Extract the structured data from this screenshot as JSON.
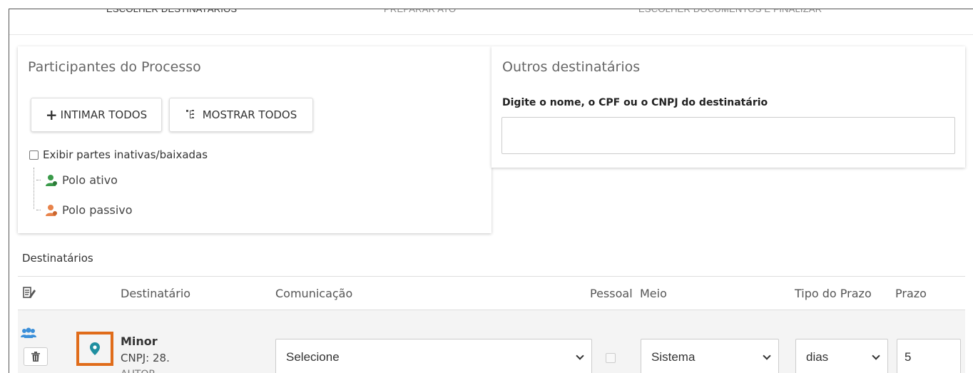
{
  "steps": [
    "Escolher destinatários",
    "Preparar ato",
    "Escolher documentos e finalizar"
  ],
  "participants": {
    "title": "Participantes do Processo",
    "intimar_label": "INTIMAR TODOS",
    "mostrar_label": "MOSTRAR TODOS",
    "checkbox_label": "Exibir partes inativas/baixadas",
    "checkbox_checked": false,
    "polos": [
      {
        "label": "Polo ativo",
        "icon": "user-green-icon",
        "color": "#3a9a4a"
      },
      {
        "label": "Polo passivo",
        "icon": "user-orange-icon",
        "color": "#e8834a"
      }
    ]
  },
  "others": {
    "title": "Outros destinatários",
    "field_label": "Digite o nome, o CPF ou o CNPJ do destinatário",
    "field_value": ""
  },
  "recipients": {
    "title": "Destinatários",
    "columns": [
      "Destinatário",
      "Comunicação",
      "Pessoal",
      "Meio",
      "Tipo do Prazo",
      "Prazo"
    ],
    "rows": [
      {
        "name": "Minor",
        "doc": "CNPJ: 28.",
        "role": "AUTOR",
        "comunicacao": "Selecione",
        "pessoal": false,
        "meio": "Sistema",
        "tipo_prazo": "dias",
        "prazo": "5"
      }
    ]
  },
  "colors": {
    "highlight": "#e06c1a",
    "pin": "#1f8fa0",
    "users_icon": "#3b8fd9"
  }
}
